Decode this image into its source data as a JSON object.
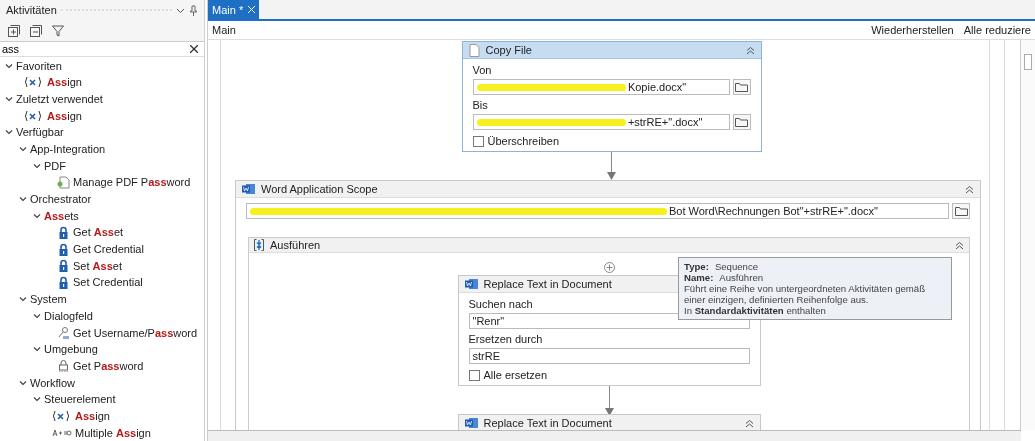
{
  "panel": {
    "title": "Aktivitäten",
    "search": {
      "value": "ass"
    },
    "tree": [
      {
        "label": "Favoriten",
        "expanded": true,
        "children": [
          {
            "label": "**Ass**ign",
            "kind": "assign"
          }
        ]
      },
      {
        "label": "Zuletzt verwendet",
        "expanded": true,
        "children": [
          {
            "label": "**Ass**ign",
            "kind": "assign"
          }
        ]
      },
      {
        "label": "Verfügbar",
        "expanded": true,
        "children": [
          {
            "label": "App-Integration",
            "expanded": true,
            "children": [
              {
                "label": "PDF",
                "expanded": true,
                "children": [
                  {
                    "label": "Manage PDF P**ass**word",
                    "kind": "pdf"
                  }
                ]
              }
            ]
          },
          {
            "label": "Orchestrator",
            "expanded": true,
            "children": [
              {
                "label": "**Ass**ets",
                "expanded": true,
                "children": [
                  {
                    "label": "Get **Ass**et",
                    "kind": "lock"
                  },
                  {
                    "label": "Get Credential",
                    "kind": "lock"
                  },
                  {
                    "label": "Set **Ass**et",
                    "kind": "lock"
                  },
                  {
                    "label": "Set Credential",
                    "kind": "lock"
                  }
                ]
              }
            ]
          },
          {
            "label": "System",
            "expanded": true,
            "children": [
              {
                "label": "Dialogfeld",
                "expanded": true,
                "children": [
                  {
                    "label": "Get Username/P**ass**word",
                    "kind": "login"
                  }
                ]
              },
              {
                "label": "Umgebung",
                "expanded": true,
                "children": [
                  {
                    "label": "Get P**ass**word",
                    "kind": "password"
                  }
                ]
              }
            ]
          },
          {
            "label": "Workflow",
            "expanded": true,
            "children": [
              {
                "label": "Steuerelement",
                "expanded": true,
                "children": [
                  {
                    "label": "**Ass**ign",
                    "kind": "assign"
                  },
                  {
                    "label": "Multiple **Ass**ign",
                    "kind": "multi-assign"
                  }
                ]
              }
            ]
          }
        ]
      }
    ]
  },
  "tabs": [
    {
      "label": "Main *",
      "selected": true
    }
  ],
  "breadcrumb": "Main",
  "toolbar": [
    "Wiederherstellen",
    "Alle reduziere"
  ],
  "copy_file": {
    "title": "Copy File",
    "selected": true,
    "fields": [
      {
        "label": "Von",
        "value": "Kopie.docx\"",
        "redacted": true
      },
      {
        "label": "Bis",
        "value": "+strRE+\".docx\"",
        "redacted": true
      }
    ],
    "checkbox": {
      "label": "Überschreiben",
      "checked": false
    }
  },
  "word_scope": {
    "title": "Word Application Scope",
    "value": "Bot Word\\Rechnungen Bot\"+strRE+\".docx\"",
    "redacted": true,
    "sequence": {
      "title": "Ausführen",
      "activities": [
        {
          "title": "Replace Text in Document",
          "fields": [
            {
              "label": "Suchen nach",
              "value": "\"Renr\""
            },
            {
              "label": "Ersetzen durch",
              "value": "strRE"
            }
          ],
          "checkbox": {
            "label": "Alle ersetzen",
            "checked": false
          }
        },
        {
          "title": "Replace Text in Document"
        }
      ]
    }
  },
  "tooltip": {
    "rows": [
      {
        "label": "Type:",
        "value": "Sequence"
      },
      {
        "label": "Name:",
        "value": "Ausführen"
      }
    ],
    "description": "Führt eine Reihe von untergeordneten Aktivitäten gemäß einer einzigen, definierten Reihenfolge aus.",
    "source": "In **Standardaktivitäten** enthalten"
  }
}
